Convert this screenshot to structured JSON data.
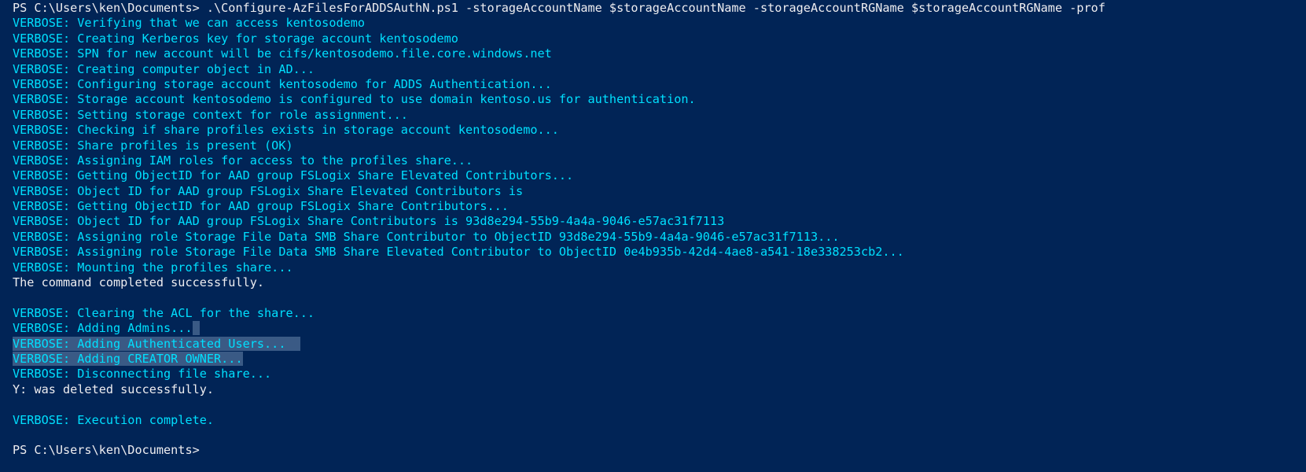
{
  "window": {
    "type": "PowerShell console"
  },
  "colors": {
    "background": "#012456",
    "output": "#eeedf0",
    "verbose": "#00e0ff",
    "selection": "#3a5a85"
  },
  "lines": [
    {
      "kind": "command",
      "text": "PS C:\\Users\\ken\\Documents> .\\Configure-AzFilesForADDSAuthN.ps1 -storageAccountName $storageAccountName -storageAccountRGName $storageAccountRGName -prof"
    },
    {
      "kind": "verbose",
      "text": "VERBOSE: Verifying that we can access kentosodemo"
    },
    {
      "kind": "verbose",
      "text": "VERBOSE: Creating Kerberos key for storage account kentosodemo"
    },
    {
      "kind": "verbose",
      "text": "VERBOSE: SPN for new account will be cifs/kentosodemo.file.core.windows.net"
    },
    {
      "kind": "verbose",
      "text": "VERBOSE: Creating computer object in AD..."
    },
    {
      "kind": "verbose",
      "text": "VERBOSE: Configuring storage account kentosodemo for ADDS Authentication..."
    },
    {
      "kind": "verbose",
      "text": "VERBOSE: Storage account kentosodemo is configured to use domain kentoso.us for authentication."
    },
    {
      "kind": "verbose",
      "text": "VERBOSE: Setting storage context for role assignment..."
    },
    {
      "kind": "verbose",
      "text": "VERBOSE: Checking if share profiles exists in storage account kentosodemo..."
    },
    {
      "kind": "verbose",
      "text": "VERBOSE: Share profiles is present (OK)"
    },
    {
      "kind": "verbose",
      "text": "VERBOSE: Assigning IAM roles for access to the profiles share..."
    },
    {
      "kind": "verbose",
      "text": "VERBOSE: Getting ObjectID for AAD group FSLogix Share Elevated Contributors..."
    },
    {
      "kind": "verbose",
      "text": "VERBOSE: Object ID for AAD group FSLogix Share Elevated Contributors is"
    },
    {
      "kind": "verbose",
      "text": "VERBOSE: Getting ObjectID for AAD group FSLogix Share Contributors..."
    },
    {
      "kind": "verbose",
      "text": "VERBOSE: Object ID for AAD group FSLogix Share Contributors is 93d8e294-55b9-4a4a-9046-e57ac31f7113"
    },
    {
      "kind": "verbose",
      "text": "VERBOSE: Assigning role Storage File Data SMB Share Contributor to ObjectID 93d8e294-55b9-4a4a-9046-e57ac31f7113..."
    },
    {
      "kind": "verbose",
      "text": "VERBOSE: Assigning role Storage File Data SMB Share Elevated Contributor to ObjectID 0e4b935b-42d4-4ae8-a541-18e338253cb2..."
    },
    {
      "kind": "verbose",
      "text": "VERBOSE: Mounting the profiles share..."
    },
    {
      "kind": "output",
      "text": "The command completed successfully."
    },
    {
      "kind": "blank",
      "text": ""
    },
    {
      "kind": "verbose",
      "text": "VERBOSE: Clearing the ACL for the share..."
    },
    {
      "kind": "verbose",
      "text": "VERBOSE: Adding Admins...",
      "selected_tail": " "
    },
    {
      "kind": "verbose",
      "text": "VERBOSE: Adding Authenticated Users...",
      "selected": true,
      "selected_tail": "  "
    },
    {
      "kind": "verbose",
      "text": "VERBOSE: Adding CREATOR OWNER...",
      "selected": true
    },
    {
      "kind": "verbose",
      "text": "VERBOSE: Disconnecting file share..."
    },
    {
      "kind": "output",
      "text": "Y: was deleted successfully."
    },
    {
      "kind": "blank",
      "text": ""
    },
    {
      "kind": "verbose",
      "text": "VERBOSE: Execution complete."
    },
    {
      "kind": "blank",
      "text": ""
    },
    {
      "kind": "prompt",
      "text": "PS C:\\Users\\ken\\Documents>"
    }
  ]
}
